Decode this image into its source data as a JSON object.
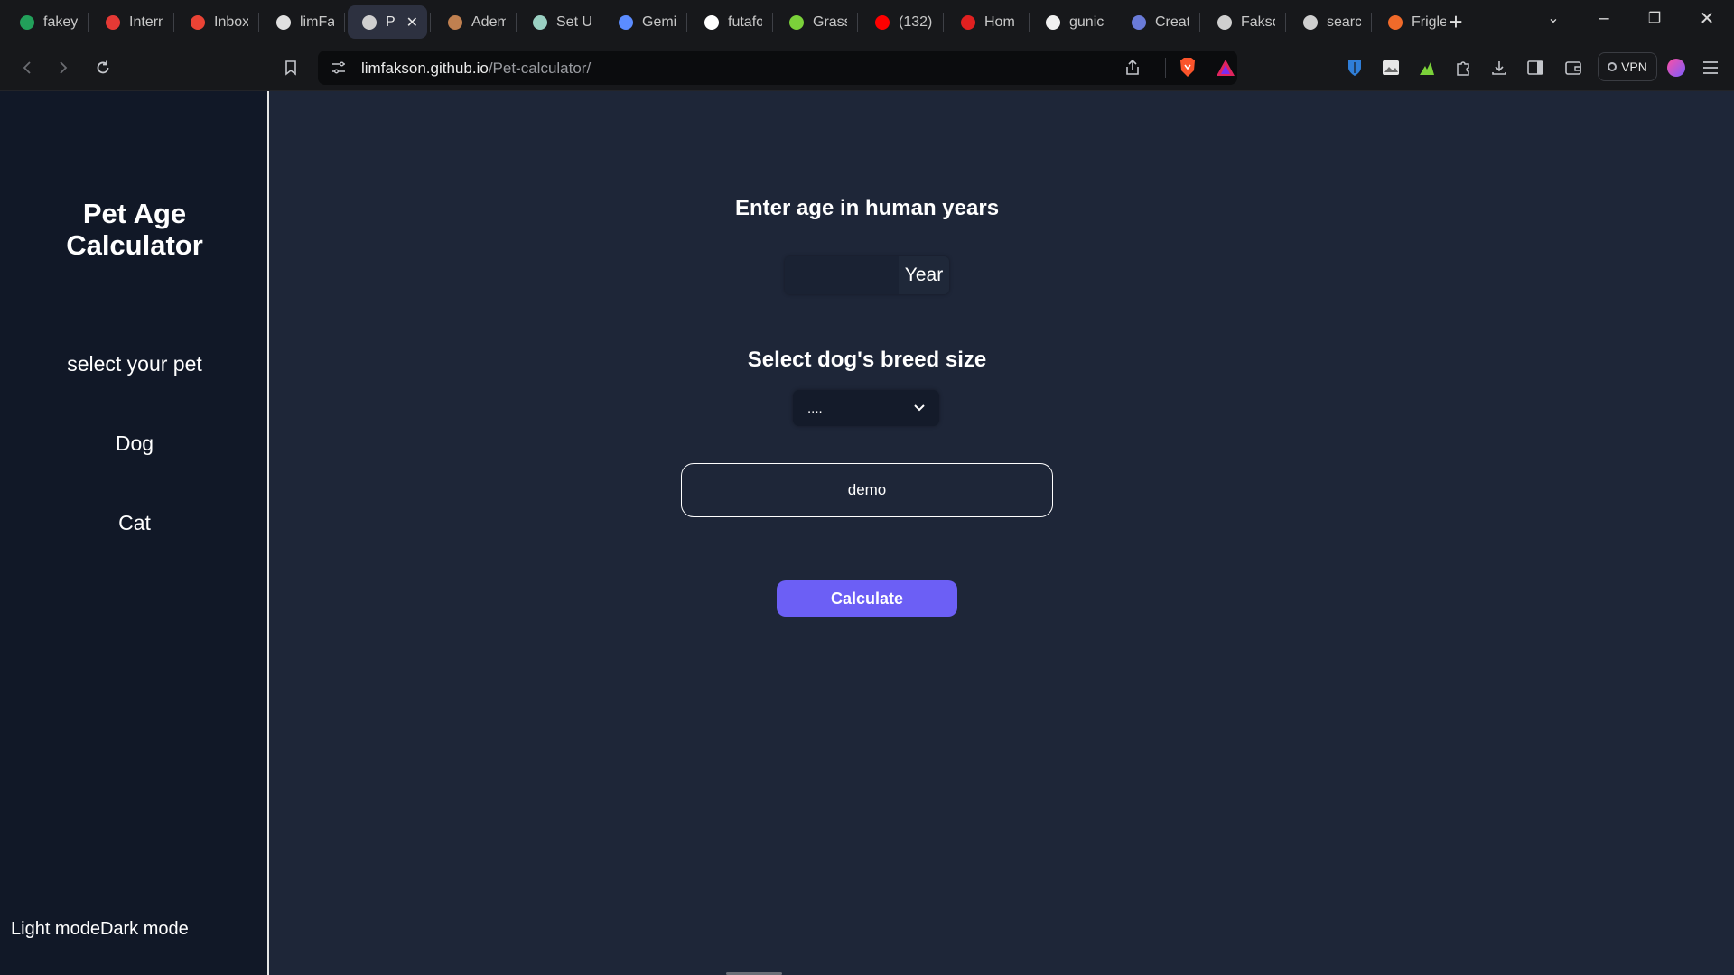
{
  "browser": {
    "tabs": [
      {
        "label": "fakey",
        "icon": "green-circle-f-icon",
        "color": "#22a05a"
      },
      {
        "label": "Intern",
        "icon": "red-arc-icon",
        "color": "#e53935"
      },
      {
        "label": "Inbox",
        "icon": "gmail-icon",
        "color": "#ea4335"
      },
      {
        "label": "limFal",
        "icon": "github-icon",
        "color": "#e0e0e0"
      },
      {
        "label": "P",
        "icon": "globe-icon",
        "color": "#cfcfcf",
        "active": true
      },
      {
        "label": "Adem",
        "icon": "avatar-icon",
        "color": "#c08050"
      },
      {
        "label": "Set U",
        "icon": "openai-icon",
        "color": "#9ad0c2"
      },
      {
        "label": "Gemi",
        "icon": "gemini-icon",
        "color": "#5b8cff"
      },
      {
        "label": "futafo",
        "icon": "triangle-icon",
        "color": "#ffffff"
      },
      {
        "label": "Grass",
        "icon": "grass-icon",
        "color": "#7bd13a"
      },
      {
        "label": "(132)",
        "icon": "youtube-icon",
        "color": "#ff0000"
      },
      {
        "label": "Hom",
        "icon": "home-pin-icon",
        "color": "#e02020"
      },
      {
        "label": "gunic",
        "icon": "hexagon-icon",
        "color": "#f0f0f0"
      },
      {
        "label": "Creat",
        "icon": "avatar-icon",
        "color": "#6a7bd8"
      },
      {
        "label": "Fakso",
        "icon": "globe-icon",
        "color": "#cfcfcf"
      },
      {
        "label": "searc",
        "icon": "globe-icon",
        "color": "#cfcfcf"
      },
      {
        "label": "Frigle",
        "icon": "f-logo-icon",
        "color": "#f06a2a"
      }
    ],
    "url_host": "limfakson.github.io",
    "url_path": "/Pet-calculator/",
    "vpn_label": "VPN"
  },
  "sidebar": {
    "title_line1": "Pet Age",
    "title_line2": "Calculator",
    "select_prompt": "select your pet",
    "pets": [
      "Dog",
      "Cat"
    ],
    "mode_toggle": "Light modeDark mode"
  },
  "main": {
    "age_heading": "Enter age in human years",
    "age_value": "",
    "age_unit": "Year",
    "breed_heading": "Select dog's breed size",
    "breed_selected": "....",
    "result_text": "demo",
    "calculate_label": "Calculate"
  },
  "colors": {
    "page_bg": "#1e2638",
    "sidebar_bg": "#111827",
    "button_accent": "#6c5ff5",
    "text": "#ffffff"
  }
}
